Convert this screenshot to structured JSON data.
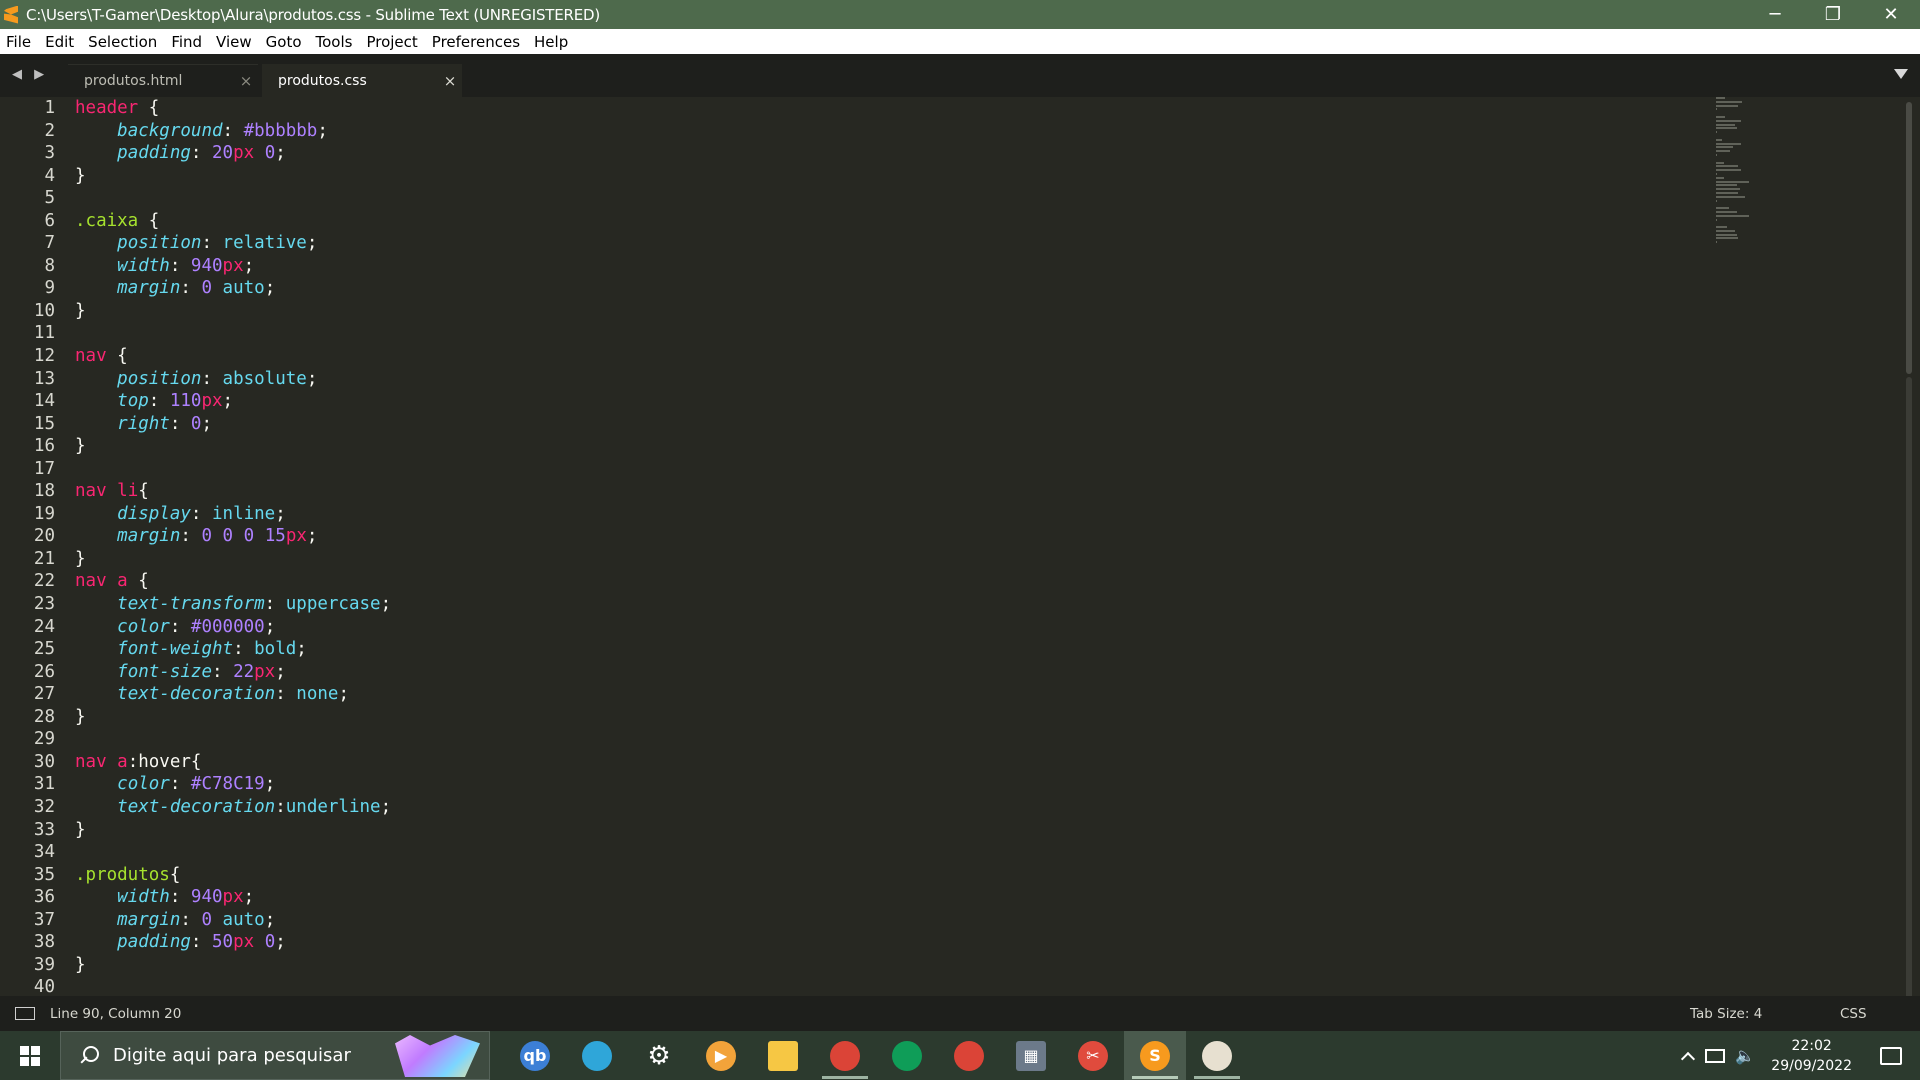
{
  "window": {
    "title": "C:\\Users\\T-Gamer\\Desktop\\Alura\\produtos.css - Sublime Text (UNREGISTERED)",
    "minimize": "─",
    "maximize": "❐",
    "close": "✕"
  },
  "menu": [
    "File",
    "Edit",
    "Selection",
    "Find",
    "View",
    "Goto",
    "Tools",
    "Project",
    "Preferences",
    "Help"
  ],
  "tabs": [
    {
      "label": "produtos.html",
      "active": false,
      "close": "×"
    },
    {
      "label": "produtos.css",
      "active": true,
      "close": "×"
    }
  ],
  "tab_nav": "◀ ▶",
  "editor": {
    "lines": [
      [
        [
          "sel",
          "header"
        ],
        [
          "pun",
          " {"
        ]
      ],
      [
        [
          "pun",
          "    "
        ],
        [
          "prop",
          "background"
        ],
        [
          "pun",
          ": "
        ],
        [
          "num",
          "#bbbbbb"
        ],
        [
          "pun",
          ";"
        ]
      ],
      [
        [
          "pun",
          "    "
        ],
        [
          "prop",
          "padding"
        ],
        [
          "pun",
          ": "
        ],
        [
          "num",
          "20"
        ],
        [
          "unit",
          "px"
        ],
        [
          "pun",
          " "
        ],
        [
          "num",
          "0"
        ],
        [
          "pun",
          ";"
        ]
      ],
      [
        [
          "pun",
          "}"
        ]
      ],
      [],
      [
        [
          "cls",
          ".caixa"
        ],
        [
          "pun",
          " {"
        ]
      ],
      [
        [
          "pun",
          "    "
        ],
        [
          "prop",
          "position"
        ],
        [
          "pun",
          ": "
        ],
        [
          "kw",
          "relative"
        ],
        [
          "pun",
          ";"
        ]
      ],
      [
        [
          "pun",
          "    "
        ],
        [
          "prop",
          "width"
        ],
        [
          "pun",
          ": "
        ],
        [
          "num",
          "940"
        ],
        [
          "unit",
          "px"
        ],
        [
          "pun",
          ";"
        ]
      ],
      [
        [
          "pun",
          "    "
        ],
        [
          "prop",
          "margin"
        ],
        [
          "pun",
          ": "
        ],
        [
          "num",
          "0"
        ],
        [
          "pun",
          " "
        ],
        [
          "kw",
          "auto"
        ],
        [
          "pun",
          ";"
        ]
      ],
      [
        [
          "pun",
          "}"
        ]
      ],
      [],
      [
        [
          "sel",
          "nav"
        ],
        [
          "pun",
          " {"
        ]
      ],
      [
        [
          "pun",
          "    "
        ],
        [
          "prop",
          "position"
        ],
        [
          "pun",
          ": "
        ],
        [
          "kw",
          "absolute"
        ],
        [
          "pun",
          ";"
        ]
      ],
      [
        [
          "pun",
          "    "
        ],
        [
          "prop",
          "top"
        ],
        [
          "pun",
          ": "
        ],
        [
          "num",
          "110"
        ],
        [
          "unit",
          "px"
        ],
        [
          "pun",
          ";"
        ]
      ],
      [
        [
          "pun",
          "    "
        ],
        [
          "prop",
          "right"
        ],
        [
          "pun",
          ": "
        ],
        [
          "num",
          "0"
        ],
        [
          "pun",
          ";"
        ]
      ],
      [
        [
          "pun",
          "}"
        ]
      ],
      [],
      [
        [
          "sel",
          "nav"
        ],
        [
          "pun",
          " "
        ],
        [
          "sel",
          "li"
        ],
        [
          "pun",
          "{"
        ]
      ],
      [
        [
          "pun",
          "    "
        ],
        [
          "prop",
          "display"
        ],
        [
          "pun",
          ": "
        ],
        [
          "kw",
          "inline"
        ],
        [
          "pun",
          ";"
        ]
      ],
      [
        [
          "pun",
          "    "
        ],
        [
          "prop",
          "margin"
        ],
        [
          "pun",
          ": "
        ],
        [
          "num",
          "0"
        ],
        [
          "pun",
          " "
        ],
        [
          "num",
          "0"
        ],
        [
          "pun",
          " "
        ],
        [
          "num",
          "0"
        ],
        [
          "pun",
          " "
        ],
        [
          "num",
          "15"
        ],
        [
          "unit",
          "px"
        ],
        [
          "pun",
          ";"
        ]
      ],
      [
        [
          "pun",
          "}"
        ]
      ],
      [
        [
          "sel",
          "nav"
        ],
        [
          "pun",
          " "
        ],
        [
          "sel",
          "a"
        ],
        [
          "pun",
          " {"
        ]
      ],
      [
        [
          "pun",
          "    "
        ],
        [
          "prop",
          "text-transform"
        ],
        [
          "pun",
          ": "
        ],
        [
          "kw",
          "uppercase"
        ],
        [
          "pun",
          ";"
        ]
      ],
      [
        [
          "pun",
          "    "
        ],
        [
          "prop",
          "color"
        ],
        [
          "pun",
          ": "
        ],
        [
          "num",
          "#000000"
        ],
        [
          "pun",
          ";"
        ]
      ],
      [
        [
          "pun",
          "    "
        ],
        [
          "prop",
          "font-weight"
        ],
        [
          "pun",
          ": "
        ],
        [
          "kw",
          "bold"
        ],
        [
          "pun",
          ";"
        ]
      ],
      [
        [
          "pun",
          "    "
        ],
        [
          "prop",
          "font-size"
        ],
        [
          "pun",
          ": "
        ],
        [
          "num",
          "22"
        ],
        [
          "unit",
          "px"
        ],
        [
          "pun",
          ";"
        ]
      ],
      [
        [
          "pun",
          "    "
        ],
        [
          "prop",
          "text-decoration"
        ],
        [
          "pun",
          ": "
        ],
        [
          "kw",
          "none"
        ],
        [
          "pun",
          ";"
        ]
      ],
      [
        [
          "pun",
          "}"
        ]
      ],
      [],
      [
        [
          "sel",
          "nav"
        ],
        [
          "pun",
          " "
        ],
        [
          "sel",
          "a"
        ],
        [
          "pun",
          ":hover{"
        ]
      ],
      [
        [
          "pun",
          "    "
        ],
        [
          "prop",
          "color"
        ],
        [
          "pun",
          ": "
        ],
        [
          "num",
          "#C78C19"
        ],
        [
          "pun",
          ";"
        ]
      ],
      [
        [
          "pun",
          "    "
        ],
        [
          "prop",
          "text-decoration"
        ],
        [
          "pun",
          ":"
        ],
        [
          "kw",
          "underline"
        ],
        [
          "pun",
          ";"
        ]
      ],
      [
        [
          "pun",
          "}"
        ]
      ],
      [],
      [
        [
          "cls",
          ".produtos"
        ],
        [
          "pun",
          "{"
        ]
      ],
      [
        [
          "pun",
          "    "
        ],
        [
          "prop",
          "width"
        ],
        [
          "pun",
          ": "
        ],
        [
          "num",
          "940"
        ],
        [
          "unit",
          "px"
        ],
        [
          "pun",
          ";"
        ]
      ],
      [
        [
          "pun",
          "    "
        ],
        [
          "prop",
          "margin"
        ],
        [
          "pun",
          ": "
        ],
        [
          "num",
          "0"
        ],
        [
          "pun",
          " "
        ],
        [
          "kw",
          "auto"
        ],
        [
          "pun",
          ";"
        ]
      ],
      [
        [
          "pun",
          "    "
        ],
        [
          "prop",
          "padding"
        ],
        [
          "pun",
          ": "
        ],
        [
          "num",
          "50"
        ],
        [
          "unit",
          "px"
        ],
        [
          "pun",
          " "
        ],
        [
          "num",
          "0"
        ],
        [
          "pun",
          ";"
        ]
      ],
      [
        [
          "pun",
          "}"
        ]
      ],
      []
    ]
  },
  "status": {
    "position": "Line 90, Column 20",
    "tab_size": "Tab Size: 4",
    "syntax": "CSS"
  },
  "taskbar": {
    "search_placeholder": "Digite aqui para pesquisar",
    "apps": [
      {
        "name": "qbittorrent-icon",
        "color": "#3c7fd6",
        "glyph": "qb",
        "running": false
      },
      {
        "name": "edge-icon",
        "color": "#2fa6d9",
        "glyph": "",
        "running": false
      },
      {
        "name": "settings-icon",
        "color": "#2c3a2e",
        "glyph": "⚙",
        "running": false
      },
      {
        "name": "media-player-icon",
        "color": "#f2a33a",
        "glyph": "▶",
        "running": false
      },
      {
        "name": "file-explorer-icon",
        "color": "#f6c744",
        "glyph": "",
        "running": false
      },
      {
        "name": "chrome-icon",
        "color": "#db4437",
        "glyph": "",
        "running": true
      },
      {
        "name": "chrome-profile-icon",
        "color": "#0f9d58",
        "glyph": "",
        "running": false
      },
      {
        "name": "chrome-profile-2-icon",
        "color": "#db4437",
        "glyph": "",
        "running": false
      },
      {
        "name": "calculator-icon",
        "color": "#6c7a8a",
        "glyph": "▦",
        "running": false
      },
      {
        "name": "snipping-tool-icon",
        "color": "#e04b3d",
        "glyph": "✂",
        "running": false
      },
      {
        "name": "sublime-text-icon",
        "color": "#f79a1e",
        "glyph": "S",
        "running": true,
        "active": true
      },
      {
        "name": "paint-icon",
        "color": "#e7e0d0",
        "glyph": "",
        "running": true
      }
    ],
    "time": "22:02",
    "date": "29/09/2022"
  }
}
